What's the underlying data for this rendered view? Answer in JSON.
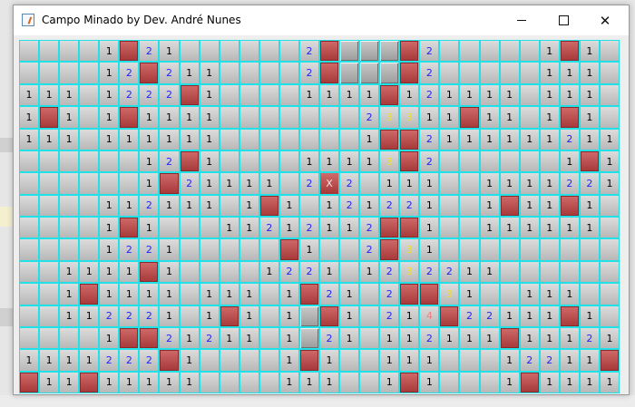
{
  "window": {
    "title": "Campo Minado by Dev. André Nunes"
  },
  "board": {
    "rows": [
      [
        "",
        "",
        "",
        "",
        "1",
        "M",
        "2",
        "1",
        "",
        "",
        "",
        "",
        "",
        "",
        "2",
        "M",
        "U",
        "U",
        "U",
        "M",
        "2",
        "",
        "",
        "",
        "",
        "",
        "1",
        "M",
        "1",
        ""
      ],
      [
        "",
        "",
        "",
        "",
        "1",
        "2",
        "M",
        "2",
        "1",
        "1",
        "",
        "",
        "",
        "",
        "2",
        "M",
        "U",
        "U",
        "U",
        "M",
        "2",
        "",
        "",
        "",
        "",
        "",
        "1",
        "1",
        "1",
        ""
      ],
      [
        "1",
        "1",
        "1",
        "",
        "1",
        "2",
        "2",
        "2",
        "M",
        "1",
        "",
        "",
        "",
        "",
        "1",
        "1",
        "1",
        "1",
        "M",
        "1",
        "2",
        "1",
        "1",
        "1",
        "1",
        "",
        "1",
        "1",
        "1",
        ""
      ],
      [
        "1",
        "M",
        "1",
        "",
        "1",
        "M",
        "1",
        "1",
        "1",
        "1",
        "",
        "",
        "",
        "",
        "",
        "",
        "",
        "2",
        "3",
        "3",
        "1",
        "1",
        "M",
        "1",
        "1",
        "",
        "1",
        "M",
        "1",
        ""
      ],
      [
        "1",
        "1",
        "1",
        "",
        "1",
        "1",
        "1",
        "1",
        "1",
        "1",
        "",
        "",
        "",
        "",
        "",
        "",
        "",
        "1",
        "M",
        "M",
        "2",
        "1",
        "1",
        "1",
        "1",
        "1",
        "1",
        "2",
        "1",
        "1"
      ],
      [
        "",
        "",
        "",
        "",
        "",
        "",
        "1",
        "2",
        "M",
        "1",
        "",
        "",
        "",
        "",
        "1",
        "1",
        "1",
        "1",
        "3",
        "M",
        "2",
        "",
        "",
        "",
        "",
        "",
        "",
        "1",
        "M",
        "1"
      ],
      [
        "",
        "",
        "",
        "",
        "",
        "",
        "1",
        "M",
        "2",
        "1",
        "1",
        "1",
        "1",
        "",
        "2",
        "X",
        "2",
        "",
        "1",
        "1",
        "1",
        "",
        "",
        "1",
        "1",
        "1",
        "1",
        "2",
        "2",
        "1"
      ],
      [
        "",
        "",
        "",
        "",
        "1",
        "1",
        "2",
        "1",
        "1",
        "1",
        "",
        "1",
        "M",
        "1",
        "",
        "1",
        "2",
        "1",
        "2",
        "2",
        "1",
        "",
        "",
        "1",
        "M",
        "1",
        "1",
        "M",
        "1",
        ""
      ],
      [
        "",
        "",
        "",
        "",
        "1",
        "M",
        "1",
        "",
        "",
        "",
        "1",
        "1",
        "2",
        "1",
        "2",
        "1",
        "1",
        "2",
        "M",
        "M",
        "1",
        "",
        "",
        "1",
        "1",
        "1",
        "1",
        "1",
        "1",
        ""
      ],
      [
        "",
        "",
        "",
        "",
        "1",
        "2",
        "2",
        "1",
        "",
        "",
        "",
        "",
        "",
        "M",
        "1",
        "",
        "",
        "2",
        "M",
        "3",
        "1",
        "",
        "",
        "",
        "",
        "",
        "",
        "",
        "",
        ""
      ],
      [
        "",
        "",
        "1",
        "1",
        "1",
        "1",
        "M",
        "1",
        "",
        "",
        "",
        "",
        "1",
        "2",
        "2",
        "1",
        "",
        "1",
        "2",
        "3",
        "2",
        "2",
        "1",
        "1",
        "",
        "",
        "",
        "",
        "",
        ""
      ],
      [
        "",
        "",
        "1",
        "M",
        "1",
        "1",
        "1",
        "1",
        "",
        "1",
        "1",
        "1",
        "",
        "1",
        "M",
        "2",
        "1",
        "",
        "2",
        "M",
        "M",
        "3",
        "1",
        "",
        "",
        "1",
        "1",
        "1",
        "",
        ""
      ],
      [
        "",
        "",
        "1",
        "1",
        "2",
        "2",
        "2",
        "1",
        "",
        "1",
        "M",
        "1",
        "",
        "1",
        "U",
        "M",
        "1",
        "",
        "2",
        "1",
        "4",
        "M",
        "2",
        "2",
        "1",
        "1",
        "1",
        "M",
        "1",
        ""
      ],
      [
        "",
        "",
        "",
        "",
        "1",
        "M",
        "M",
        "2",
        "1",
        "2",
        "1",
        "1",
        "",
        "1",
        "U",
        "2",
        "1",
        "",
        "1",
        "1",
        "2",
        "1",
        "1",
        "1",
        "M",
        "1",
        "1",
        "1",
        "2",
        "1"
      ],
      [
        "1",
        "1",
        "1",
        "1",
        "2",
        "2",
        "2",
        "M",
        "1",
        "",
        "",
        "",
        "",
        "1",
        "M",
        "1",
        "",
        "",
        "1",
        "1",
        "1",
        "",
        "",
        "",
        "1",
        "2",
        "2",
        "1",
        "1",
        "M"
      ],
      [
        "M",
        "1",
        "1",
        "M",
        "1",
        "1",
        "1",
        "1",
        "1",
        "",
        "",
        "",
        "",
        "1",
        "1",
        "1",
        "",
        "",
        "1",
        "M",
        "1",
        "",
        "",
        "",
        "1",
        "M",
        "1",
        "1",
        "1",
        "1"
      ]
    ]
  }
}
